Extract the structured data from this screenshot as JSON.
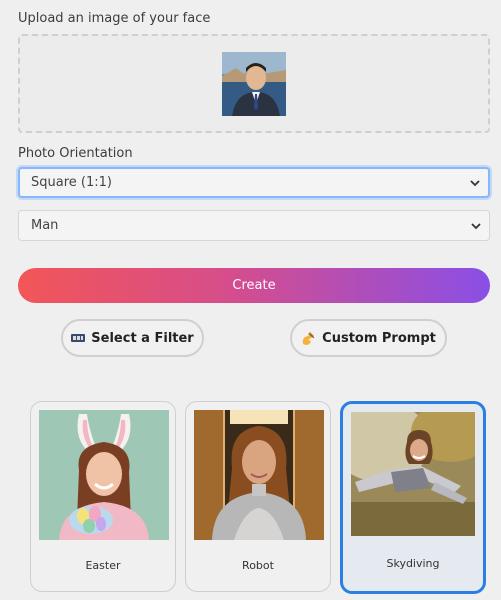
{
  "upload": {
    "label": "Upload an image of your face"
  },
  "orientation": {
    "label": "Photo Orientation",
    "selected": "Square (1:1)"
  },
  "gender": {
    "selected": "Man"
  },
  "create": {
    "label": "Create"
  },
  "filter_button": {
    "icon": "film-frames-icon",
    "label": "Select a Filter"
  },
  "prompt_button": {
    "icon": "writing-hand-icon",
    "label": "Custom Prompt"
  },
  "filters": [
    {
      "label": "Easter",
      "selected": false
    },
    {
      "label": "Robot",
      "selected": false
    },
    {
      "label": "Skydiving",
      "selected": true
    }
  ],
  "colors": {
    "accent_start": "#f25657",
    "accent_end": "#8a4fe6",
    "selected_border": "#2a7fe0"
  }
}
